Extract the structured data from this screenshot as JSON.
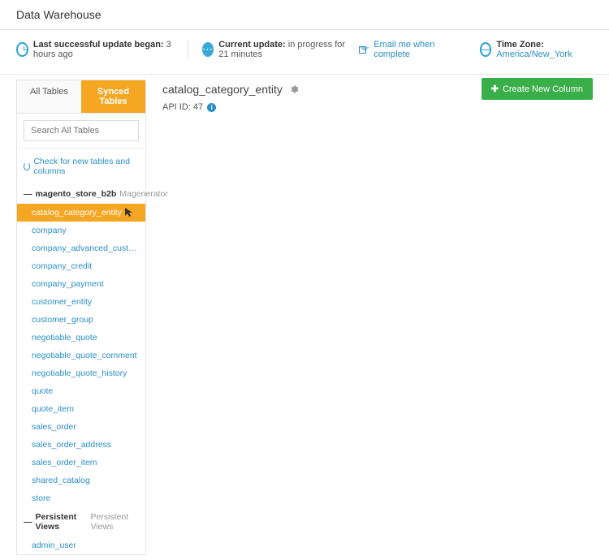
{
  "header": {
    "title": "Data Warehouse"
  },
  "status": {
    "update_label": "Last successful update began:",
    "update_value": "3 hours ago",
    "current_label": "Current update:",
    "current_value": "in progress for 21 minutes",
    "email_link": "Email me when complete",
    "tz_label": "Time Zone:",
    "tz_value": "America/New_York"
  },
  "sidebar": {
    "tabs": {
      "all": "All Tables",
      "synced": "Synced Tables"
    },
    "search_placeholder": "Search All Tables",
    "check_link": "Check for new tables and columns",
    "group1": {
      "name": "magento_store_b2b",
      "sub": "Magenerator"
    },
    "items": [
      "catalog_category_entity",
      "company",
      "company_advanced_customer_entity",
      "company_credit",
      "company_payment",
      "customer_entity",
      "customer_group",
      "negotiable_quote",
      "negotiable_quote_comment",
      "negotiable_quote_history",
      "quote",
      "quote_item",
      "sales_order",
      "sales_order_address",
      "sales_order_item",
      "shared_catalog",
      "store"
    ],
    "group2": {
      "name": "Persistent Views",
      "sub": "Persistent Views"
    },
    "items2": [
      "admin_user"
    ]
  },
  "main": {
    "table_title": "catalog_category_entity",
    "api_label": "API ID:",
    "api_value": "47",
    "create_btn": "Create New Column"
  }
}
